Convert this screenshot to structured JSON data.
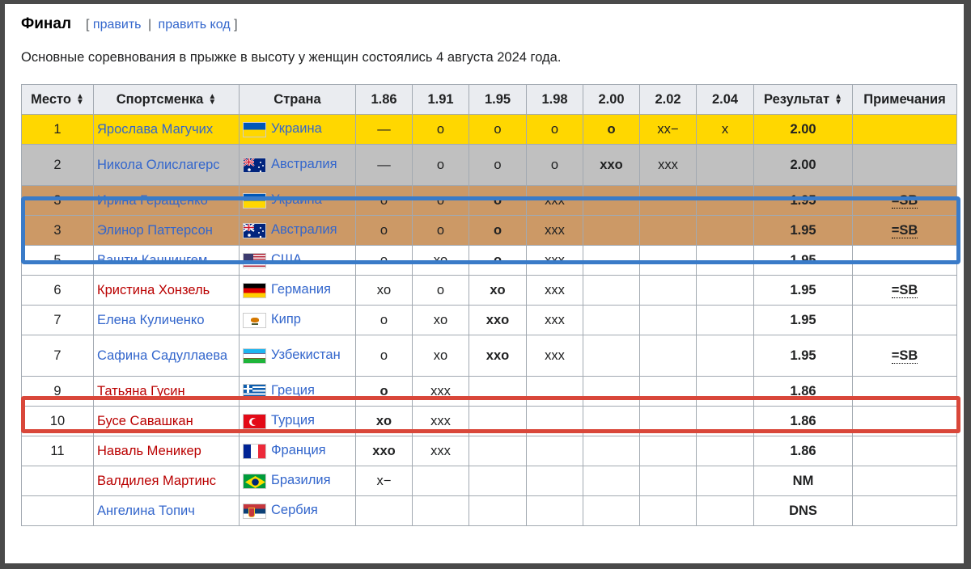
{
  "section": {
    "title": "Финал",
    "edit_open": "[",
    "edit_link": "править",
    "edit_sep": "|",
    "edit_code_link": "править код",
    "edit_close": "]"
  },
  "intro": "Основные соревнования в прыжке в высоту у женщин состоялись 4 августа 2024 года.",
  "table": {
    "headers": {
      "place": "Место",
      "athlete": "Спортсменка",
      "country": "Страна",
      "h186": "1.86",
      "h191": "1.91",
      "h195": "1.95",
      "h198": "1.98",
      "h200": "2.00",
      "h202": "2.02",
      "h204": "2.04",
      "result": "Результат",
      "notes": "Примечания"
    },
    "rows": [
      {
        "place": "1",
        "name": "Ярослава Магучих",
        "country": "Украина",
        "a186": "—",
        "a191": "o",
        "a195": "o",
        "a198": "o",
        "a200": "o",
        "a202": "xx−",
        "a204": "x",
        "result": "2.00",
        "note": ""
      },
      {
        "place": "2",
        "name": "Никола Олислагерс",
        "country": "Австралия",
        "a186": "—",
        "a191": "o",
        "a195": "o",
        "a198": "o",
        "a200": "xxo",
        "a202": "xxx",
        "a204": "",
        "result": "2.00",
        "note": ""
      },
      {
        "place": "3",
        "name": "Ирина Геращенко",
        "country": "Украина",
        "a186": "o",
        "a191": "o",
        "a195": "o",
        "a198": "xxx",
        "a200": "",
        "a202": "",
        "a204": "",
        "result": "1.95",
        "note": "=SB"
      },
      {
        "place": "3",
        "name": "Элинор Паттерсон",
        "country": "Австралия",
        "a186": "o",
        "a191": "o",
        "a195": "o",
        "a198": "xxx",
        "a200": "",
        "a202": "",
        "a204": "",
        "result": "1.95",
        "note": "=SB"
      },
      {
        "place": "5",
        "name": "Вашти Каннингем",
        "country": "США",
        "a186": "o",
        "a191": "xo",
        "a195": "o",
        "a198": "xxx",
        "a200": "",
        "a202": "",
        "a204": "",
        "result": "1.95",
        "note": ""
      },
      {
        "place": "6",
        "name": "Кристина Хонзель",
        "country": "Германия",
        "a186": "xo",
        "a191": "o",
        "a195": "xo",
        "a198": "xxx",
        "a200": "",
        "a202": "",
        "a204": "",
        "result": "1.95",
        "note": "=SB"
      },
      {
        "place": "7",
        "name": "Елена Куличенко",
        "country": "Кипр",
        "a186": "o",
        "a191": "xo",
        "a195": "xxo",
        "a198": "xxx",
        "a200": "",
        "a202": "",
        "a204": "",
        "result": "1.95",
        "note": ""
      },
      {
        "place": "7",
        "name": "Сафина Садуллаева",
        "country": "Узбекистан",
        "a186": "o",
        "a191": "xo",
        "a195": "xxo",
        "a198": "xxx",
        "a200": "",
        "a202": "",
        "a204": "",
        "result": "1.95",
        "note": "=SB"
      },
      {
        "place": "9",
        "name": "Татьяна Гусин",
        "country": "Греция",
        "a186": "o",
        "a191": "xxx",
        "a195": "",
        "a198": "",
        "a200": "",
        "a202": "",
        "a204": "",
        "result": "1.86",
        "note": ""
      },
      {
        "place": "10",
        "name": "Бусе Савашкан",
        "country": "Турция",
        "a186": "xo",
        "a191": "xxx",
        "a195": "",
        "a198": "",
        "a200": "",
        "a202": "",
        "a204": "",
        "result": "1.86",
        "note": ""
      },
      {
        "place": "11",
        "name": "Наваль Меникер",
        "country": "Франция",
        "a186": "xxo",
        "a191": "xxx",
        "a195": "",
        "a198": "",
        "a200": "",
        "a202": "",
        "a204": "",
        "result": "1.86",
        "note": ""
      },
      {
        "place": "",
        "name": "Валдилея Мартинс",
        "country": "Бразилия",
        "a186": "x−",
        "a191": "",
        "a195": "",
        "a198": "",
        "a200": "",
        "a202": "",
        "a204": "",
        "result": "NM",
        "note": ""
      },
      {
        "place": "",
        "name": "Ангелина Топич",
        "country": "Сербия",
        "a186": "",
        "a191": "",
        "a195": "",
        "a198": "",
        "a200": "",
        "a202": "",
        "a204": "",
        "result": "DNS",
        "note": ""
      }
    ]
  },
  "colors": {
    "gold": "#ffd700",
    "silver": "#c0c0c0",
    "bronze": "#cc9966",
    "link": "#3366cc",
    "redlink": "#ba0000",
    "highlight_blue": "#3a7bc8",
    "highlight_red": "#d9473a"
  }
}
